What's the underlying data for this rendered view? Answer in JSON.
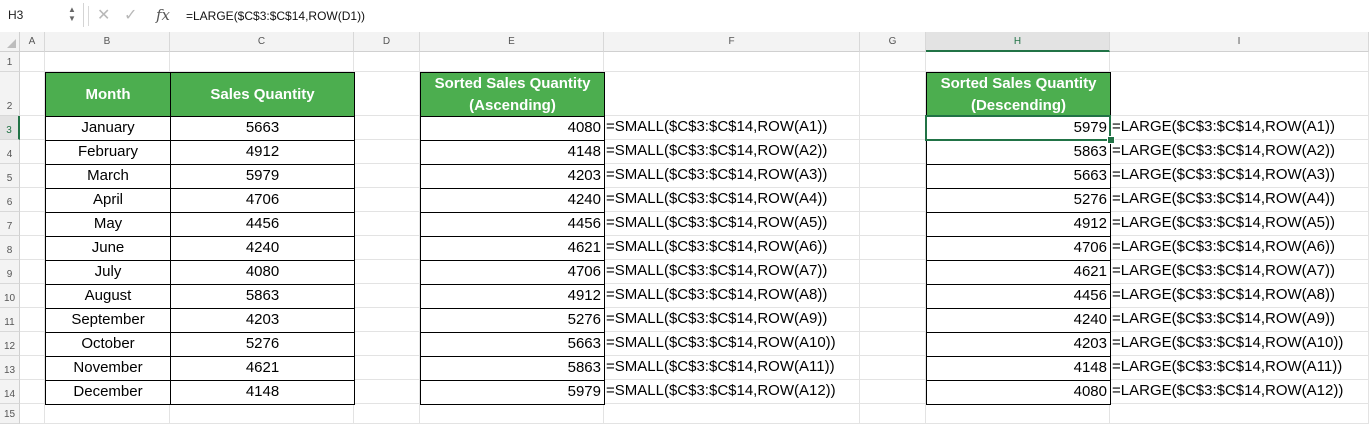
{
  "formula_bar": {
    "name_box": "H3",
    "cancel_icon": "close-icon",
    "enter_icon": "check-icon",
    "fx_label": "fx",
    "formula": "=LARGE($C$3:$C$14,ROW(D1))"
  },
  "columns": [
    "A",
    "B",
    "C",
    "D",
    "E",
    "F",
    "G",
    "H",
    "I"
  ],
  "rows": [
    "1",
    "2",
    "3",
    "4",
    "5",
    "6",
    "7",
    "8",
    "9",
    "10",
    "11",
    "12",
    "13",
    "14",
    "15"
  ],
  "selected_cell": "H3",
  "accent_color": "#217346",
  "header_fill": "#4cae4f",
  "table1": {
    "headers": [
      "Month",
      "Sales Quantity"
    ],
    "rows": [
      [
        "January",
        "5663"
      ],
      [
        "February",
        "4912"
      ],
      [
        "March",
        "5979"
      ],
      [
        "April",
        "4706"
      ],
      [
        "May",
        "4456"
      ],
      [
        "June",
        "4240"
      ],
      [
        "July",
        "4080"
      ],
      [
        "August",
        "5863"
      ],
      [
        "September",
        "4203"
      ],
      [
        "October",
        "5276"
      ],
      [
        "November",
        "4621"
      ],
      [
        "December",
        "4148"
      ]
    ]
  },
  "table2": {
    "header": "Sorted Sales Quantity (Ascending)",
    "values": [
      "4080",
      "4148",
      "4203",
      "4240",
      "4456",
      "4621",
      "4706",
      "4912",
      "5276",
      "5663",
      "5863",
      "5979"
    ],
    "formulas": [
      "=SMALL($C$3:$C$14,ROW(A1))",
      "=SMALL($C$3:$C$14,ROW(A2))",
      "=SMALL($C$3:$C$14,ROW(A3))",
      "=SMALL($C$3:$C$14,ROW(A4))",
      "=SMALL($C$3:$C$14,ROW(A5))",
      "=SMALL($C$3:$C$14,ROW(A6))",
      "=SMALL($C$3:$C$14,ROW(A7))",
      "=SMALL($C$3:$C$14,ROW(A8))",
      "=SMALL($C$3:$C$14,ROW(A9))",
      "=SMALL($C$3:$C$14,ROW(A10))",
      "=SMALL($C$3:$C$14,ROW(A11))",
      "=SMALL($C$3:$C$14,ROW(A12))"
    ]
  },
  "table3": {
    "header": "Sorted Sales Quantity (Descending)",
    "values": [
      "5979",
      "5863",
      "5663",
      "5276",
      "4912",
      "4706",
      "4621",
      "4456",
      "4240",
      "4203",
      "4148",
      "4080"
    ],
    "formulas": [
      "=LARGE($C$3:$C$14,ROW(A1))",
      "=LARGE($C$3:$C$14,ROW(A2))",
      "=LARGE($C$3:$C$14,ROW(A3))",
      "=LARGE($C$3:$C$14,ROW(A4))",
      "=LARGE($C$3:$C$14,ROW(A5))",
      "=LARGE($C$3:$C$14,ROW(A6))",
      "=LARGE($C$3:$C$14,ROW(A7))",
      "=LARGE($C$3:$C$14,ROW(A8))",
      "=LARGE($C$3:$C$14,ROW(A9))",
      "=LARGE($C$3:$C$14,ROW(A10))",
      "=LARGE($C$3:$C$14,ROW(A11))",
      "=LARGE($C$3:$C$14,ROW(A12))"
    ]
  }
}
